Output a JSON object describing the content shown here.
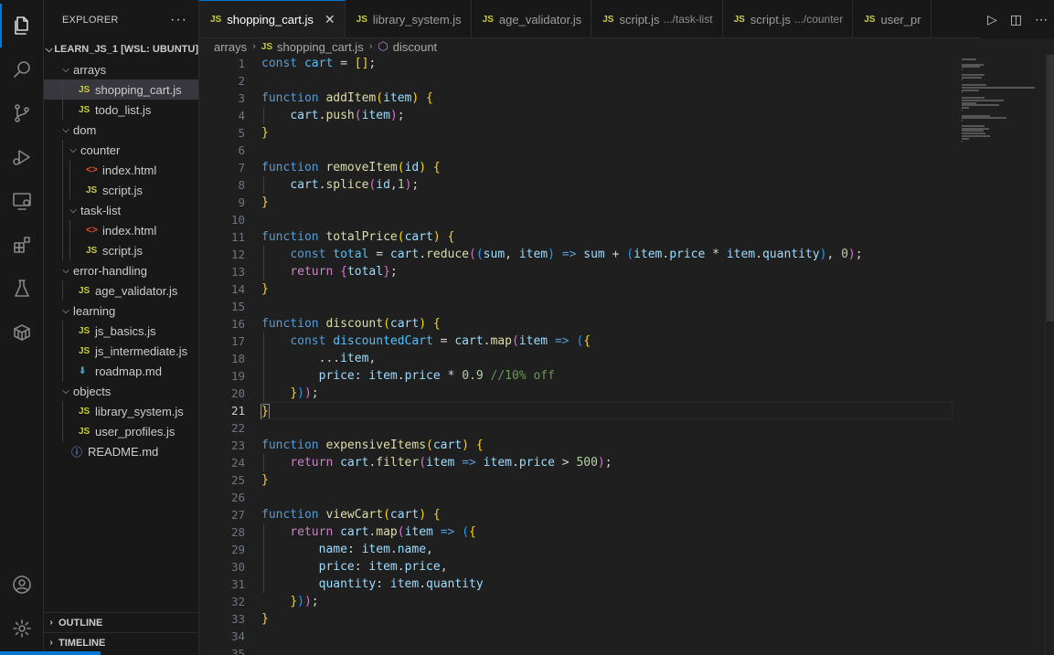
{
  "activity_bar": {
    "items": [
      {
        "icon": "explorer-icon",
        "active": true
      },
      {
        "icon": "search-icon"
      },
      {
        "icon": "source-control-icon"
      },
      {
        "icon": "run-debug-icon"
      },
      {
        "icon": "remote-explorer-icon"
      },
      {
        "icon": "extensions-icon"
      },
      {
        "icon": "testing-icon"
      },
      {
        "icon": "containers-icon"
      }
    ],
    "bottom": [
      {
        "icon": "account-icon"
      },
      {
        "icon": "manage-gear-icon"
      }
    ]
  },
  "sidebar": {
    "title": "EXPLORER",
    "more": "···",
    "root": "LEARN_JS_1 [WSL: UBUNTU]",
    "tree": [
      {
        "label": "arrays",
        "type": "folder",
        "depth": 1,
        "open": true
      },
      {
        "label": "shopping_cart.js",
        "type": "js",
        "depth": 2,
        "selected": true
      },
      {
        "label": "todo_list.js",
        "type": "js",
        "depth": 2
      },
      {
        "label": "dom",
        "type": "folder",
        "depth": 1,
        "open": true
      },
      {
        "label": "counter",
        "type": "folder",
        "depth": 2,
        "open": true
      },
      {
        "label": "index.html",
        "type": "html",
        "depth": 3
      },
      {
        "label": "script.js",
        "type": "js",
        "depth": 3
      },
      {
        "label": "task-list",
        "type": "folder",
        "depth": 2,
        "open": true
      },
      {
        "label": "index.html",
        "type": "html",
        "depth": 3
      },
      {
        "label": "script.js",
        "type": "js",
        "depth": 3
      },
      {
        "label": "error-handling",
        "type": "folder",
        "depth": 1,
        "open": true
      },
      {
        "label": "age_validator.js",
        "type": "js",
        "depth": 2
      },
      {
        "label": "learning",
        "type": "folder",
        "depth": 1,
        "open": true
      },
      {
        "label": "js_basics.js",
        "type": "js",
        "depth": 2
      },
      {
        "label": "js_intermediate.js",
        "type": "js",
        "depth": 2
      },
      {
        "label": "roadmap.md",
        "type": "md",
        "depth": 2
      },
      {
        "label": "objects",
        "type": "folder",
        "depth": 1,
        "open": true
      },
      {
        "label": "library_system.js",
        "type": "js",
        "depth": 2
      },
      {
        "label": "user_profiles.js",
        "type": "js",
        "depth": 2
      },
      {
        "label": "README.md",
        "type": "info",
        "depth": 1
      }
    ],
    "outline": "OUTLINE",
    "timeline": "TIMELINE"
  },
  "tabs": [
    {
      "label": "shopping_cart.js",
      "active": true,
      "close": "✕"
    },
    {
      "label": "library_system.js"
    },
    {
      "label": "age_validator.js"
    },
    {
      "label": "script.js",
      "desc": ".../task-list"
    },
    {
      "label": "script.js",
      "desc": ".../counter"
    },
    {
      "label": "user_pr"
    }
  ],
  "tab_badge": "JS",
  "breadcrumb": {
    "folder": "arrays",
    "file": "shopping_cart.js",
    "symbol": "discount"
  },
  "editor": {
    "current_line": 21,
    "lines": [
      [
        [
          "kw",
          "const"
        ],
        [
          "op",
          " "
        ],
        [
          "cn",
          "cart"
        ],
        [
          "op",
          " = "
        ],
        [
          "p1",
          "[]"
        ],
        [
          "op",
          ";"
        ]
      ],
      [],
      [
        [
          "kw",
          "function"
        ],
        [
          "op",
          " "
        ],
        [
          "fn",
          "addItem"
        ],
        [
          "p1",
          "("
        ],
        [
          "vr",
          "item"
        ],
        [
          "p1",
          ")"
        ],
        [
          "op",
          " "
        ],
        [
          "p1",
          "{"
        ]
      ],
      [
        [
          "op",
          "    "
        ],
        [
          "vr",
          "cart"
        ],
        [
          "op",
          "."
        ],
        [
          "fn",
          "push"
        ],
        [
          "p2",
          "("
        ],
        [
          "vr",
          "item"
        ],
        [
          "p2",
          ")"
        ],
        [
          "op",
          ";"
        ]
      ],
      [
        [
          "p1",
          "}"
        ]
      ],
      [],
      [
        [
          "kw",
          "function"
        ],
        [
          "op",
          " "
        ],
        [
          "fn",
          "removeItem"
        ],
        [
          "p1",
          "("
        ],
        [
          "vr",
          "id"
        ],
        [
          "p1",
          ")"
        ],
        [
          "op",
          " "
        ],
        [
          "p1",
          "{"
        ]
      ],
      [
        [
          "op",
          "    "
        ],
        [
          "vr",
          "cart"
        ],
        [
          "op",
          "."
        ],
        [
          "fn",
          "splice"
        ],
        [
          "p2",
          "("
        ],
        [
          "vr",
          "id"
        ],
        [
          "op",
          ","
        ],
        [
          "num",
          "1"
        ],
        [
          "p2",
          ")"
        ],
        [
          "op",
          ";"
        ]
      ],
      [
        [
          "p1",
          "}"
        ]
      ],
      [],
      [
        [
          "kw",
          "function"
        ],
        [
          "op",
          " "
        ],
        [
          "fn",
          "totalPrice"
        ],
        [
          "p1",
          "("
        ],
        [
          "vr",
          "cart"
        ],
        [
          "p1",
          ")"
        ],
        [
          "op",
          " "
        ],
        [
          "p1",
          "{"
        ]
      ],
      [
        [
          "op",
          "    "
        ],
        [
          "kw",
          "const"
        ],
        [
          "op",
          " "
        ],
        [
          "cn",
          "total"
        ],
        [
          "op",
          " = "
        ],
        [
          "vr",
          "cart"
        ],
        [
          "op",
          "."
        ],
        [
          "fn",
          "reduce"
        ],
        [
          "p2",
          "("
        ],
        [
          "p3",
          "("
        ],
        [
          "vr",
          "sum"
        ],
        [
          "op",
          ", "
        ],
        [
          "vr",
          "item"
        ],
        [
          "p3",
          ")"
        ],
        [
          "op",
          " "
        ],
        [
          "kw",
          "=>"
        ],
        [
          "op",
          " "
        ],
        [
          "vr",
          "sum"
        ],
        [
          "op",
          " + "
        ],
        [
          "p3",
          "("
        ],
        [
          "vr",
          "item"
        ],
        [
          "op",
          "."
        ],
        [
          "vr",
          "price"
        ],
        [
          "op",
          " * "
        ],
        [
          "vr",
          "item"
        ],
        [
          "op",
          "."
        ],
        [
          "vr",
          "quantity"
        ],
        [
          "p3",
          ")"
        ],
        [
          "op",
          ", "
        ],
        [
          "num",
          "0"
        ],
        [
          "p2",
          ")"
        ],
        [
          "op",
          ";"
        ]
      ],
      [
        [
          "op",
          "    "
        ],
        [
          "kw2",
          "return"
        ],
        [
          "op",
          " "
        ],
        [
          "p2",
          "{"
        ],
        [
          "vr",
          "total"
        ],
        [
          "p2",
          "}"
        ],
        [
          "op",
          ";"
        ]
      ],
      [
        [
          "p1",
          "}"
        ]
      ],
      [],
      [
        [
          "kw",
          "function"
        ],
        [
          "op",
          " "
        ],
        [
          "fn",
          "discount"
        ],
        [
          "p1",
          "("
        ],
        [
          "vr",
          "cart"
        ],
        [
          "p1",
          ")"
        ],
        [
          "op",
          " "
        ],
        [
          "p1",
          "{"
        ]
      ],
      [
        [
          "op",
          "    "
        ],
        [
          "kw",
          "const"
        ],
        [
          "op",
          " "
        ],
        [
          "cn",
          "discountedCart"
        ],
        [
          "op",
          " = "
        ],
        [
          "vr",
          "cart"
        ],
        [
          "op",
          "."
        ],
        [
          "fn",
          "map"
        ],
        [
          "p2",
          "("
        ],
        [
          "vr",
          "item"
        ],
        [
          "op",
          " "
        ],
        [
          "kw",
          "=>"
        ],
        [
          "op",
          " "
        ],
        [
          "p3",
          "("
        ],
        [
          "p1",
          "{"
        ]
      ],
      [
        [
          "op",
          "        ..."
        ],
        [
          "vr",
          "item"
        ],
        [
          "op",
          ","
        ]
      ],
      [
        [
          "op",
          "        "
        ],
        [
          "vr",
          "price"
        ],
        [
          "op",
          ": "
        ],
        [
          "vr",
          "item"
        ],
        [
          "op",
          "."
        ],
        [
          "vr",
          "price"
        ],
        [
          "op",
          " * "
        ],
        [
          "num",
          "0.9"
        ],
        [
          "op",
          " "
        ],
        [
          "cm",
          "//10% off"
        ]
      ],
      [
        [
          "op",
          "    "
        ],
        [
          "p1",
          "}"
        ],
        [
          "p3",
          ")"
        ],
        [
          "p2",
          ")"
        ],
        [
          "op",
          ";"
        ]
      ],
      [
        [
          "p1",
          "}"
        ]
      ],
      [],
      [
        [
          "kw",
          "function"
        ],
        [
          "op",
          " "
        ],
        [
          "fn",
          "expensiveItems"
        ],
        [
          "p1",
          "("
        ],
        [
          "vr",
          "cart"
        ],
        [
          "p1",
          ")"
        ],
        [
          "op",
          " "
        ],
        [
          "p1",
          "{"
        ]
      ],
      [
        [
          "op",
          "    "
        ],
        [
          "kw2",
          "return"
        ],
        [
          "op",
          " "
        ],
        [
          "vr",
          "cart"
        ],
        [
          "op",
          "."
        ],
        [
          "fn",
          "filter"
        ],
        [
          "p2",
          "("
        ],
        [
          "vr",
          "item"
        ],
        [
          "op",
          " "
        ],
        [
          "kw",
          "=>"
        ],
        [
          "op",
          " "
        ],
        [
          "vr",
          "item"
        ],
        [
          "op",
          "."
        ],
        [
          "vr",
          "price"
        ],
        [
          "op",
          " > "
        ],
        [
          "num",
          "500"
        ],
        [
          "p2",
          ")"
        ],
        [
          "op",
          ";"
        ]
      ],
      [
        [
          "p1",
          "}"
        ]
      ],
      [],
      [
        [
          "kw",
          "function"
        ],
        [
          "op",
          " "
        ],
        [
          "fn",
          "viewCart"
        ],
        [
          "p1",
          "("
        ],
        [
          "vr",
          "cart"
        ],
        [
          "p1",
          ")"
        ],
        [
          "op",
          " "
        ],
        [
          "p1",
          "{"
        ]
      ],
      [
        [
          "op",
          "    "
        ],
        [
          "kw2",
          "return"
        ],
        [
          "op",
          " "
        ],
        [
          "vr",
          "cart"
        ],
        [
          "op",
          "."
        ],
        [
          "fn",
          "map"
        ],
        [
          "p2",
          "("
        ],
        [
          "vr",
          "item"
        ],
        [
          "op",
          " "
        ],
        [
          "kw",
          "=>"
        ],
        [
          "op",
          " "
        ],
        [
          "p3",
          "("
        ],
        [
          "p1",
          "{"
        ]
      ],
      [
        [
          "op",
          "        "
        ],
        [
          "vr",
          "name"
        ],
        [
          "op",
          ": "
        ],
        [
          "vr",
          "item"
        ],
        [
          "op",
          "."
        ],
        [
          "vr",
          "name"
        ],
        [
          "op",
          ","
        ]
      ],
      [
        [
          "op",
          "        "
        ],
        [
          "vr",
          "price"
        ],
        [
          "op",
          ": "
        ],
        [
          "vr",
          "item"
        ],
        [
          "op",
          "."
        ],
        [
          "vr",
          "price"
        ],
        [
          "op",
          ","
        ]
      ],
      [
        [
          "op",
          "        "
        ],
        [
          "vr",
          "quantity"
        ],
        [
          "op",
          ": "
        ],
        [
          "vr",
          "item"
        ],
        [
          "op",
          "."
        ],
        [
          "vr",
          "quantity"
        ]
      ],
      [
        [
          "op",
          "    "
        ],
        [
          "p1",
          "}"
        ],
        [
          "p3",
          ")"
        ],
        [
          "p2",
          ")"
        ],
        [
          "op",
          ";"
        ]
      ],
      [
        [
          "p1",
          "}"
        ]
      ],
      [],
      []
    ]
  }
}
